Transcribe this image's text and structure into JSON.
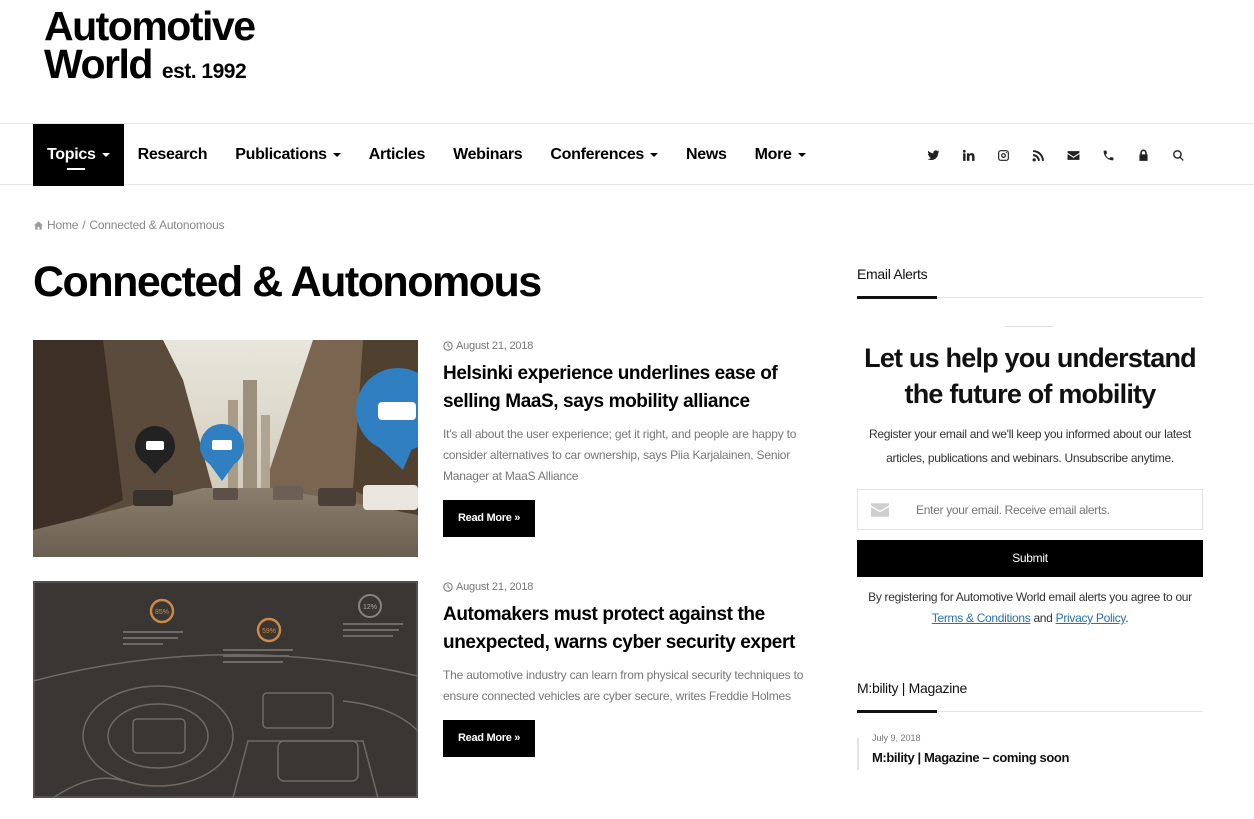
{
  "brand": {
    "line1": "Automotive",
    "line2": "World",
    "est": "est. 1992"
  },
  "nav": {
    "items": [
      {
        "label": "Topics",
        "dropdown": true,
        "active": true
      },
      {
        "label": "Research",
        "dropdown": false
      },
      {
        "label": "Publications",
        "dropdown": true
      },
      {
        "label": "Articles",
        "dropdown": false
      },
      {
        "label": "Webinars",
        "dropdown": false
      },
      {
        "label": "Conferences",
        "dropdown": true
      },
      {
        "label": "News",
        "dropdown": false
      },
      {
        "label": "More",
        "dropdown": true
      }
    ],
    "icons": [
      "twitter-icon",
      "linkedin-icon",
      "instagram-icon",
      "rss-icon",
      "envelope-icon",
      "phone-icon",
      "lock-icon",
      "search-icon"
    ]
  },
  "breadcrumb": {
    "home": "Home",
    "separator": "/",
    "current": "Connected & Autonomous"
  },
  "page_title": "Connected & Autonomous",
  "articles": [
    {
      "date": "August 21, 2018",
      "headline": "Helsinki experience underlines ease of selling MaaS, says mobility alliance",
      "excerpt": "It's all about the user experience; get it right, and people are happy to consider alternatives to car ownership, says Piia Karjalainen, Senior Manager at MaaS Alliance",
      "read_more": "Read More »"
    },
    {
      "date": "August 21, 2018",
      "headline": "Automakers must protect against the unexpected, warns cyber security expert",
      "excerpt": "The automotive industry can learn from physical security techniques to ensure connected vehicles are cyber secure, writes Freddie Holmes",
      "read_more": "Read More »",
      "image_stats": [
        "85%",
        "59%",
        "12%"
      ]
    }
  ],
  "sidebar": {
    "email_alerts": {
      "title": "Email Alerts",
      "heading": "Let us help you understand the future of mobility",
      "text": "Register your email and we'll keep you informed about our latest articles, publications and webinars. Unsubscribe anytime.",
      "placeholder": "Enter your email. Receive email alerts.",
      "submit": "Submit",
      "legal_prefix": "By registering for Automotive World email alerts you agree to our",
      "terms": "Terms & Conditions",
      "and": "and",
      "privacy": "Privacy Policy",
      "period": "."
    },
    "magazine": {
      "title": "M:bility | Magazine",
      "post_date": "July 9, 2018",
      "post_title": "M:bility | Magazine – coming soon"
    }
  },
  "colors": {
    "accent": "#000000",
    "link": "#2a6fb0",
    "pin_blue": "#2f7fc1"
  }
}
